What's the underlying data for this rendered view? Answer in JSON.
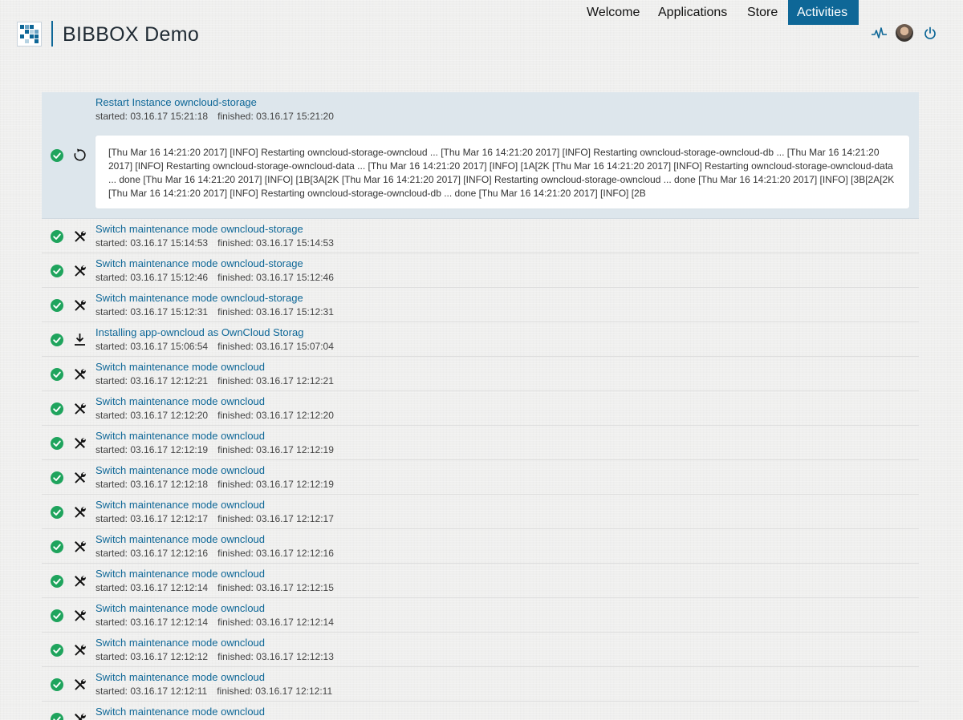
{
  "header": {
    "app_title": "BIBBOX Demo",
    "nav": [
      {
        "label": "Welcome",
        "active": false
      },
      {
        "label": "Applications",
        "active": false
      },
      {
        "label": "Store",
        "active": false
      },
      {
        "label": "Activities",
        "active": true
      }
    ],
    "icons": [
      "activity-pulse-icon",
      "avatar",
      "power-icon"
    ],
    "accent_color": "#0e6797"
  },
  "activities": [
    {
      "title": "Restart Instance owncloud-storage",
      "started": "started: 03.16.17 15:21:18",
      "finished": "finished: 03.16.17 15:21:20",
      "status": "success",
      "kind": "restart-icon",
      "log": "[Thu Mar 16 14:21:20 2017] [INFO] Restarting owncloud-storage-owncloud ... [Thu Mar 16 14:21:20 2017] [INFO] Restarting owncloud-storage-owncloud-db ... [Thu Mar 16 14:21:20 2017] [INFO] Restarting owncloud-storage-owncloud-data ... [Thu Mar 16 14:21:20 2017] [INFO] [1A[2K [Thu Mar 16 14:21:20 2017] [INFO] Restarting owncloud-storage-owncloud-data ... done [Thu Mar 16 14:21:20 2017] [INFO] [1B[3A[2K [Thu Mar 16 14:21:20 2017] [INFO] Restarting owncloud-storage-owncloud ... done [Thu Mar 16 14:21:20 2017] [INFO] [3B[2A[2K [Thu Mar 16 14:21:20 2017] [INFO] Restarting owncloud-storage-owncloud-db ... done [Thu Mar 16 14:21:20 2017] [INFO] [2B"
    },
    {
      "title": "Switch maintenance mode owncloud-storage",
      "started": "started: 03.16.17 15:14:53",
      "finished": "finished: 03.16.17 15:14:53",
      "status": "success",
      "kind": "wrench-icon"
    },
    {
      "title": "Switch maintenance mode owncloud-storage",
      "started": "started: 03.16.17 15:12:46",
      "finished": "finished: 03.16.17 15:12:46",
      "status": "success",
      "kind": "wrench-icon"
    },
    {
      "title": "Switch maintenance mode owncloud-storage",
      "started": "started: 03.16.17 15:12:31",
      "finished": "finished: 03.16.17 15:12:31",
      "status": "success",
      "kind": "wrench-icon"
    },
    {
      "title": "Installing app-owncloud as OwnCloud Storag",
      "started": "started: 03.16.17 15:06:54",
      "finished": "finished: 03.16.17 15:07:04",
      "status": "success",
      "kind": "download-icon"
    },
    {
      "title": "Switch maintenance mode owncloud",
      "started": "started: 03.16.17 12:12:21",
      "finished": "finished: 03.16.17 12:12:21",
      "status": "success",
      "kind": "wrench-icon"
    },
    {
      "title": "Switch maintenance mode owncloud",
      "started": "started: 03.16.17 12:12:20",
      "finished": "finished: 03.16.17 12:12:20",
      "status": "success",
      "kind": "wrench-icon"
    },
    {
      "title": "Switch maintenance mode owncloud",
      "started": "started: 03.16.17 12:12:19",
      "finished": "finished: 03.16.17 12:12:19",
      "status": "success",
      "kind": "wrench-icon"
    },
    {
      "title": "Switch maintenance mode owncloud",
      "started": "started: 03.16.17 12:12:18",
      "finished": "finished: 03.16.17 12:12:19",
      "status": "success",
      "kind": "wrench-icon"
    },
    {
      "title": "Switch maintenance mode owncloud",
      "started": "started: 03.16.17 12:12:17",
      "finished": "finished: 03.16.17 12:12:17",
      "status": "success",
      "kind": "wrench-icon"
    },
    {
      "title": "Switch maintenance mode owncloud",
      "started": "started: 03.16.17 12:12:16",
      "finished": "finished: 03.16.17 12:12:16",
      "status": "success",
      "kind": "wrench-icon"
    },
    {
      "title": "Switch maintenance mode owncloud",
      "started": "started: 03.16.17 12:12:14",
      "finished": "finished: 03.16.17 12:12:15",
      "status": "success",
      "kind": "wrench-icon"
    },
    {
      "title": "Switch maintenance mode owncloud",
      "started": "started: 03.16.17 12:12:14",
      "finished": "finished: 03.16.17 12:12:14",
      "status": "success",
      "kind": "wrench-icon"
    },
    {
      "title": "Switch maintenance mode owncloud",
      "started": "started: 03.16.17 12:12:12",
      "finished": "finished: 03.16.17 12:12:13",
      "status": "success",
      "kind": "wrench-icon"
    },
    {
      "title": "Switch maintenance mode owncloud",
      "started": "started: 03.16.17 12:12:11",
      "finished": "finished: 03.16.17 12:12:11",
      "status": "success",
      "kind": "wrench-icon"
    },
    {
      "title": "Switch maintenance mode owncloud",
      "started": "",
      "finished": "",
      "status": "success",
      "kind": "wrench-icon"
    }
  ]
}
